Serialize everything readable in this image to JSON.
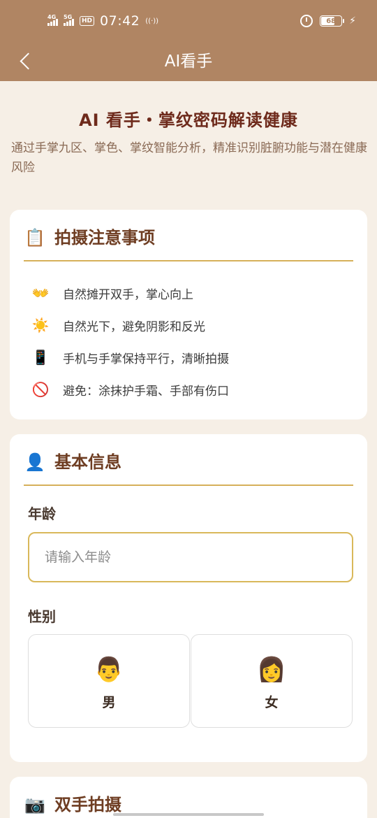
{
  "status_bar": {
    "network_1": "4G",
    "network_2": "5G",
    "hd_badge": "HD",
    "time": "07:42",
    "battery": "68",
    "battery_level_percent": 68
  },
  "header": {
    "title": "AI看手",
    "bg_color": "#b08563"
  },
  "hero": {
    "title": "AI 看手・掌纹密码解读健康",
    "subtitle": "通过手掌九区、掌色、掌纹智能分析，精准识别脏腑功能与潜在健康风险"
  },
  "tips_card": {
    "icon": "clipboard-icon",
    "title": "拍摄注意事项",
    "items": [
      {
        "icon": "hands-icon",
        "glyph": "👐",
        "text": "自然摊开双手，掌心向上"
      },
      {
        "icon": "sun-icon",
        "glyph": "☀️",
        "text": "自然光下，避免阴影和反光"
      },
      {
        "icon": "phone-icon",
        "glyph": "📱",
        "text": "手机与手掌保持平行，清晰拍摄"
      },
      {
        "icon": "prohibited-icon",
        "glyph": "🚫",
        "text": "避免：涂抹护手霜、手部有伤口"
      }
    ]
  },
  "info_card": {
    "icon": "person-icon",
    "title": "基本信息",
    "age_label": "年龄",
    "age_placeholder": "请输入年龄",
    "age_value": "",
    "gender_label": "性别",
    "genders": [
      {
        "icon": "man-icon",
        "glyph": "👨",
        "label": "男"
      },
      {
        "icon": "woman-icon",
        "glyph": "👩",
        "label": "女"
      }
    ]
  },
  "photo_card": {
    "icon": "camera-icon",
    "title": "双手拍摄"
  },
  "colors": {
    "accent": "#d6b05a",
    "title_text": "#6e2a1b",
    "background": "#f6efe6"
  }
}
